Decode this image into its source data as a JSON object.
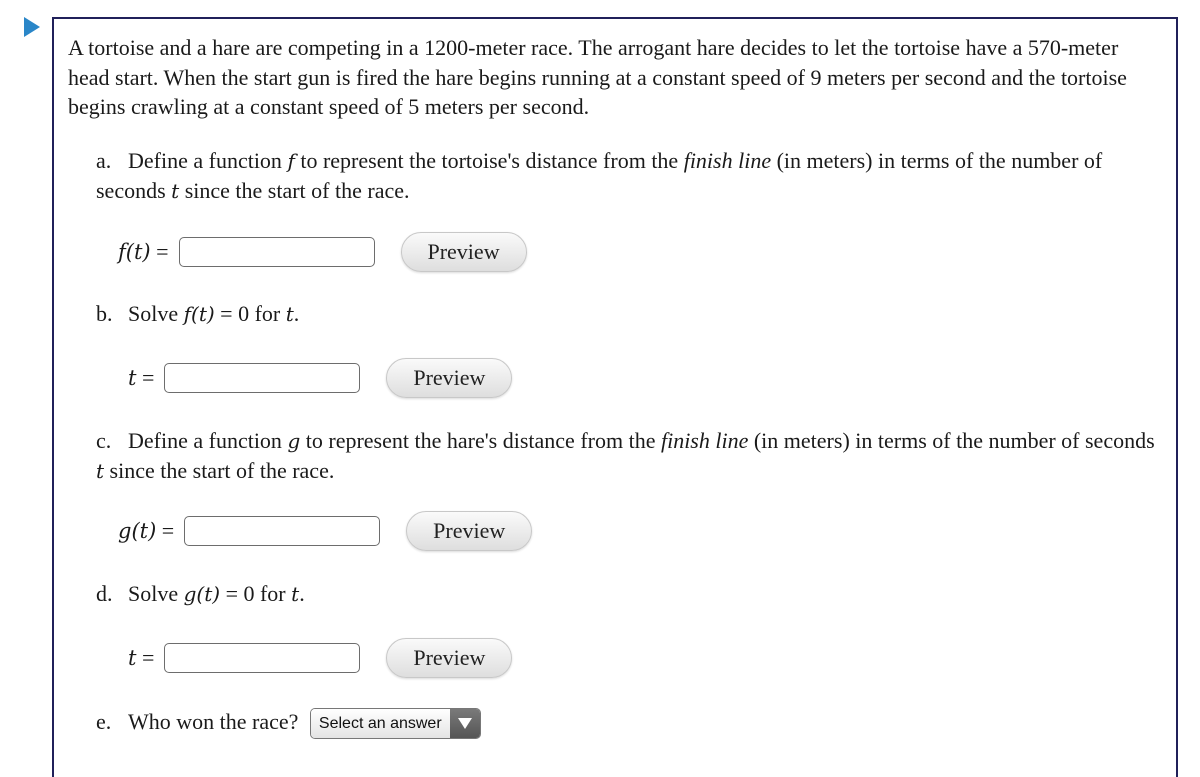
{
  "intro": "A tortoise and a hare are competing in a 1200-meter race. The arrogant hare decides to let the tortoise have a 570-meter head start. When the start gun is fired the hare begins running at a constant speed of 9 meters per second and the tortoise begins crawling at a constant speed of 5 meters per second.",
  "parts": {
    "a": {
      "letter": "a.",
      "text1": "Define a function",
      "var": "f",
      "text2": "to represent the tortoise's distance from the",
      "emph": "finish line",
      "text3": "(in meters) in terms of the number of seconds",
      "tvar": "t",
      "text4": "since the start of the race.",
      "answer_label": "f(t)",
      "eq": "=",
      "input_value": "",
      "preview_label": "Preview"
    },
    "b": {
      "letter": "b.",
      "text1": "Solve",
      "expr": "f(t)",
      "text2": "= 0 for",
      "tvar": "t",
      "text3": ".",
      "answer_label": "t",
      "eq": "=",
      "input_value": "",
      "preview_label": "Preview"
    },
    "c": {
      "letter": "c.",
      "text1": "Define a function",
      "var": "g",
      "text2": "to represent the hare's distance from the",
      "emph": "finish line",
      "text3": "(in meters) in terms of the number of seconds",
      "tvar": "t",
      "text4": "since the start of the race.",
      "answer_label": "g(t)",
      "eq": "=",
      "input_value": "",
      "preview_label": "Preview"
    },
    "d": {
      "letter": "d.",
      "text1": "Solve",
      "expr": "g(t)",
      "text2": "= 0 for",
      "tvar": "t",
      "text3": ".",
      "answer_label": "t",
      "eq": "=",
      "input_value": "",
      "preview_label": "Preview"
    },
    "e": {
      "letter": "e.",
      "text1": "Who won the race?",
      "select_value": "Select an answer"
    }
  },
  "colors": {
    "border": "#20205a",
    "collapse_icon": "#2a86c8"
  }
}
